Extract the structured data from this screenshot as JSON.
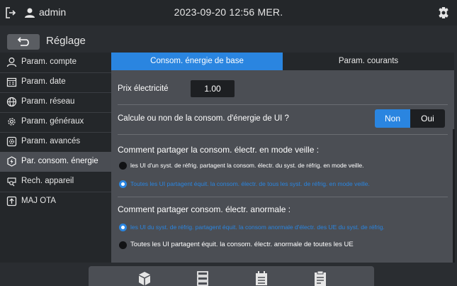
{
  "topbar": {
    "username": "admin",
    "datetime": "2023-09-20 12:56 MER."
  },
  "page": {
    "title": "Réglage"
  },
  "sidebar": {
    "items": [
      {
        "label": "Param. compte",
        "icon": "user-icon"
      },
      {
        "label": "Param. date",
        "icon": "calendar-icon"
      },
      {
        "label": "Param. réseau",
        "icon": "globe-icon"
      },
      {
        "label": "Param. généraux",
        "icon": "gear-icon"
      },
      {
        "label": "Param. avancés",
        "icon": "advanced-gear-icon"
      },
      {
        "label": "Par. consom. énergie",
        "icon": "energy-icon",
        "active": true
      },
      {
        "label": "Rech. appareil",
        "icon": "device-search-icon"
      },
      {
        "label": "MAJ OTA",
        "icon": "upload-icon"
      }
    ]
  },
  "tabs": {
    "basic": "Consom. énergie de base",
    "current": "Param. courants"
  },
  "price": {
    "label": "Prix électricité",
    "value": "1.00"
  },
  "calc": {
    "question": "Calcule ou non de la consom. d'énergie de UI ?",
    "non": "Non",
    "oui": "Oui",
    "selected": "Non"
  },
  "standby": {
    "title": "Comment partager la consom. électr. en mode veille :",
    "option1": "les UI d'un syst. de réfrig. partagent la consom. électr. du syst. de réfrig. en mode veille.",
    "option2": "Toutes les UI partagent équit. la consom. électr. de tous les syst. de réfrig. en mode veille.",
    "selected": 2
  },
  "abnormal": {
    "title": "Comment partager consom. électr. anormale :",
    "option1": "les UI du syst. de réfrig. partagent équit. la consom anormale d'électr. des UE du syst. de réfrig.",
    "option2": "Toutes les UI partagent équit. la consom. électr. anormale de toutes les UE",
    "selected": 1
  },
  "colors": {
    "accent": "#2a85e0",
    "background": "#2a2d31",
    "panel": "#4b4e54",
    "sidebar": "#24272a"
  },
  "bottom_icons": [
    "cube-icon",
    "list-icon",
    "calendar-icon",
    "document-icon"
  ]
}
